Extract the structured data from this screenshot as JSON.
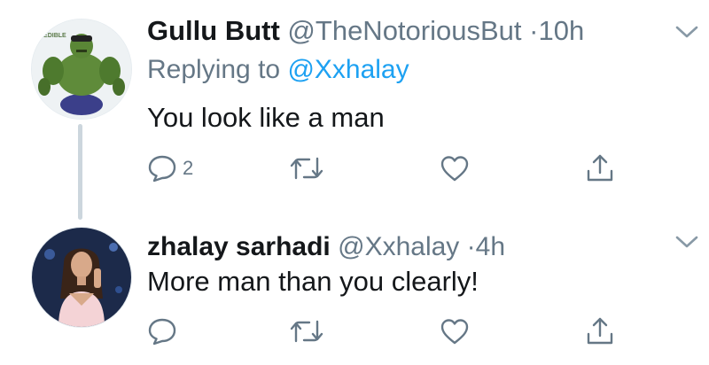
{
  "tweets": [
    {
      "name": "Gullu Butt",
      "handle": "@TheNotoriousBut",
      "separator": "·",
      "time": "10h",
      "replying_prefix": "Replying to",
      "replying_to": "@Xxhalay",
      "text": "You look like a man",
      "reply_count": "2",
      "avatar_badge": "REDIBLE",
      "avatar_icon": "hulk-avatar"
    },
    {
      "name": "zhalay sarhadi",
      "handle": "@Xxhalay",
      "separator": "·",
      "time": "4h",
      "text": "More man than you clearly!",
      "avatar_icon": "woman-avatar"
    }
  ],
  "colors": {
    "text": "#14171a",
    "secondary": "#657786",
    "accent": "#1da1f2",
    "thread_line": "#ccd6dd",
    "icon": "#657786"
  }
}
